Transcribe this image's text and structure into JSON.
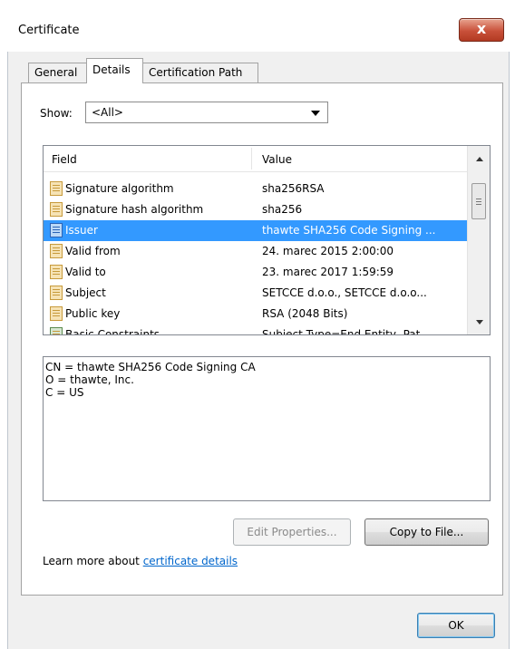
{
  "window": {
    "title": "Certificate",
    "close_glyph": "x"
  },
  "tabs": [
    {
      "label": "General",
      "active": false
    },
    {
      "label": "Details",
      "active": true
    },
    {
      "label": "Certification Path",
      "active": false
    }
  ],
  "show": {
    "label": "Show:",
    "selected": "<All>"
  },
  "list": {
    "columns": [
      "Field",
      "Value"
    ],
    "rows": [
      {
        "field": "Signature algorithm",
        "value": "sha256RSA",
        "icon": "certificate-field-icon"
      },
      {
        "field": "Signature hash algorithm",
        "value": "sha256",
        "icon": "certificate-field-icon"
      },
      {
        "field": "Issuer",
        "value": "thawte SHA256 Code Signing ...",
        "icon": "certificate-field-icon",
        "selected": true
      },
      {
        "field": "Valid from",
        "value": "24. marec 2015 2:00:00",
        "icon": "certificate-field-icon"
      },
      {
        "field": "Valid to",
        "value": "23. marec 2017 1:59:59",
        "icon": "certificate-field-icon"
      },
      {
        "field": "Subject",
        "value": "SETCCE d.o.o., SETCCE d.o.o...",
        "icon": "certificate-field-icon"
      },
      {
        "field": "Public key",
        "value": "RSA (2048 Bits)",
        "icon": "certificate-field-icon"
      },
      {
        "field": "Basic Constraints",
        "value": "Subject Type=End Entity, Pat...",
        "icon": "extension-icon"
      }
    ]
  },
  "detail_lines": [
    "CN = thawte SHA256 Code Signing CA",
    "O = thawte, Inc.",
    "C = US"
  ],
  "buttons": {
    "edit_properties": "Edit Properties...",
    "copy_to_file": "Copy to File...",
    "ok": "OK"
  },
  "learn_more": {
    "prefix": "Learn more about ",
    "link": "certificate details"
  },
  "colors": {
    "selection": "#3399ff",
    "link": "#0066cc",
    "close_button": "#c9513a"
  }
}
